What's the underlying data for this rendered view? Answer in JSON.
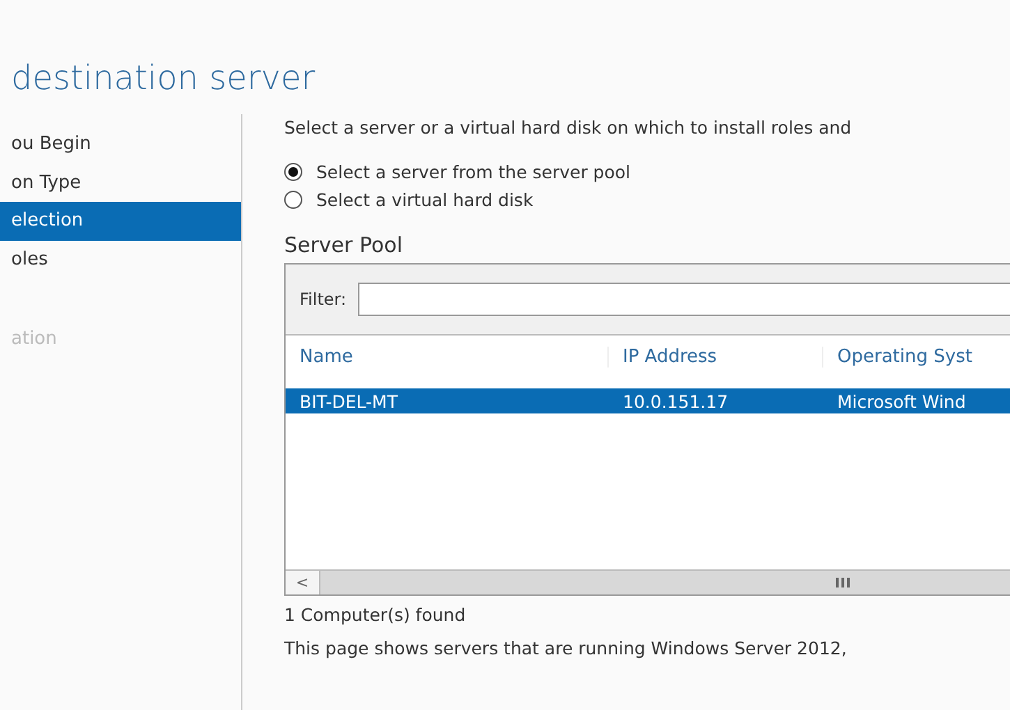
{
  "title": "destination server",
  "sidebar": {
    "items": [
      {
        "label": "ou Begin",
        "selected": false,
        "disabled": false
      },
      {
        "label": "on Type",
        "selected": false,
        "disabled": false
      },
      {
        "label": "election",
        "selected": true,
        "disabled": false
      },
      {
        "label": "oles",
        "selected": false,
        "disabled": false
      },
      {
        "label": "ation",
        "selected": false,
        "disabled": true
      }
    ]
  },
  "intro": "Select a server or a virtual hard disk on which to install roles and",
  "options": [
    {
      "label": "Select a server from the server pool",
      "selected": true
    },
    {
      "label": "Select a virtual hard disk",
      "selected": false
    }
  ],
  "server_pool": {
    "heading": "Server Pool",
    "filter_label": "Filter:",
    "columns": [
      "Name",
      "IP Address",
      "Operating Syst"
    ],
    "rows": [
      {
        "cells": [
          "BIT-DEL-MT",
          "10.0.151.17",
          "Microsoft Wind"
        ],
        "selected": true
      }
    ],
    "scroll_left": "<"
  },
  "count": "1 Computer(s) found",
  "note": "This page shows servers that are running Windows Server 2012,"
}
